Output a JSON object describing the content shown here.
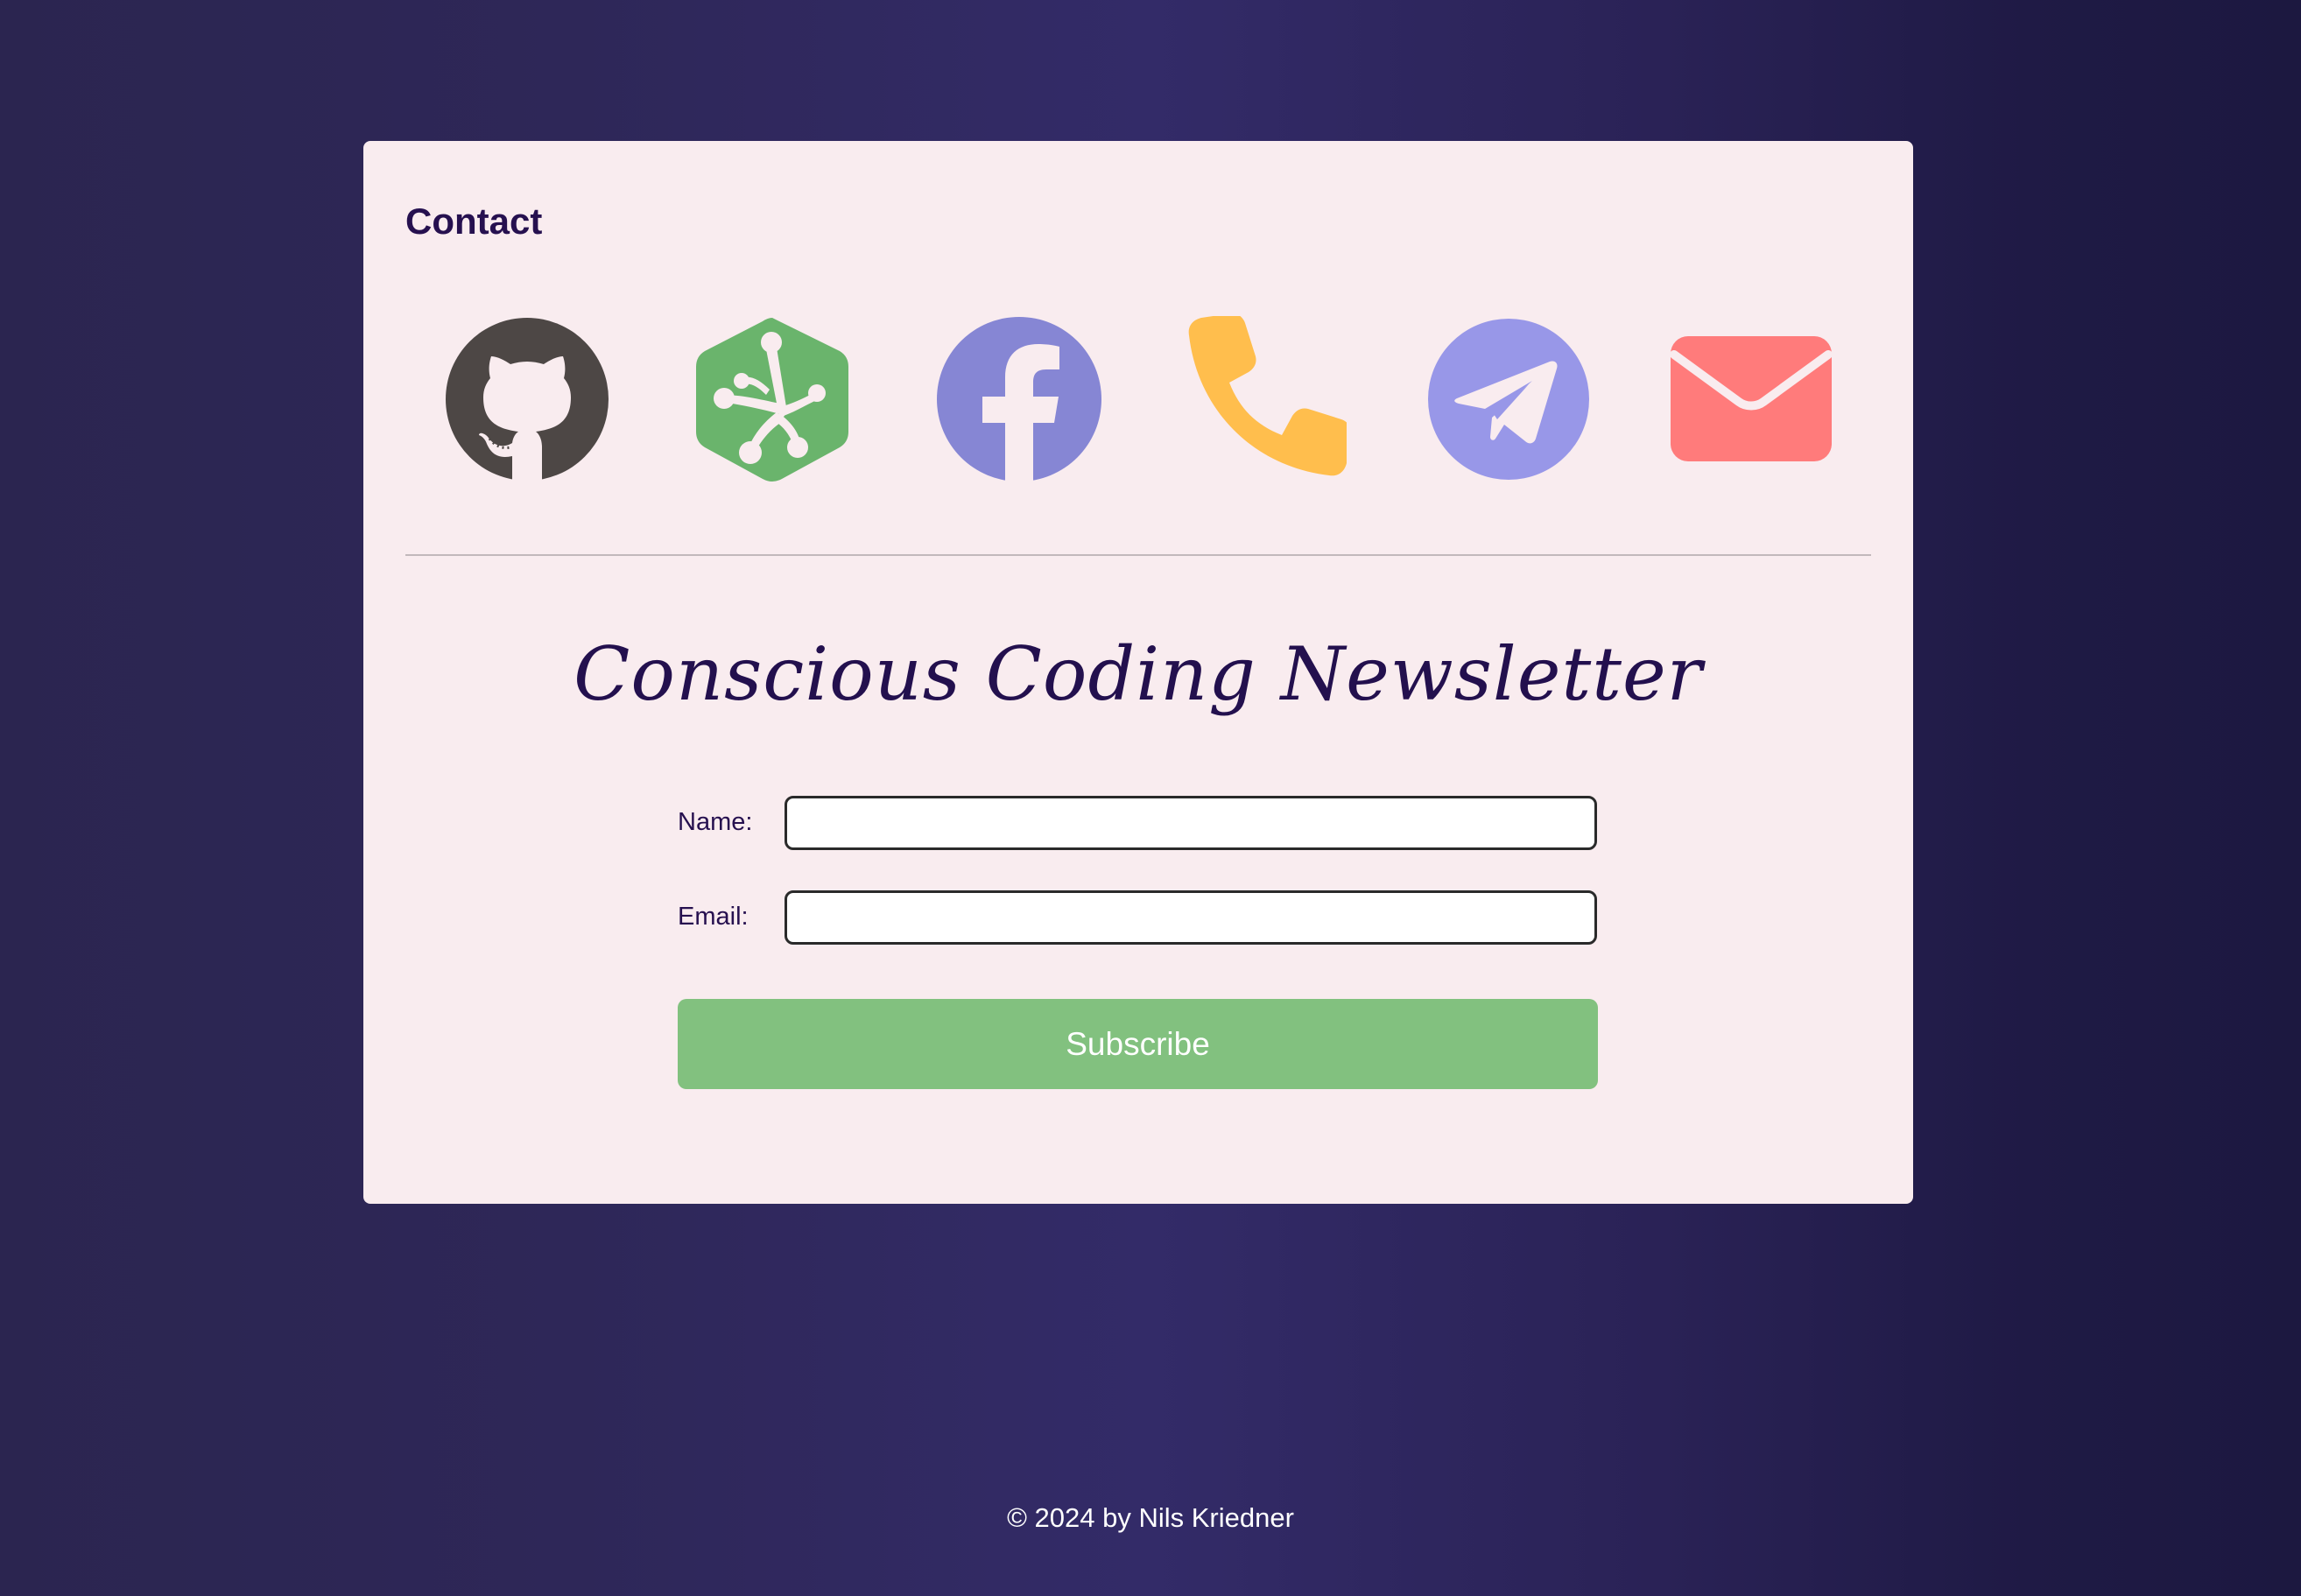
{
  "contact": {
    "title": "Contact",
    "icons": [
      {
        "name": "github-icon",
        "color": "#4d4745"
      },
      {
        "name": "treehouse-icon",
        "color": "#6ab46c"
      },
      {
        "name": "facebook-icon",
        "color": "#8686d4"
      },
      {
        "name": "phone-icon",
        "color": "#ffbe4d"
      },
      {
        "name": "telegram-icon",
        "color": "#9897e8"
      },
      {
        "name": "email-icon",
        "color": "#ff7b7b"
      }
    ]
  },
  "newsletter": {
    "title": "Conscious Coding Newsletter",
    "name_label": "Name:",
    "name_value": "",
    "email_label": "Email:",
    "email_value": "",
    "subscribe_label": "Subscribe"
  },
  "footer": {
    "text": "© 2024 by Nils Kriedner"
  },
  "colors": {
    "card_background": "#f9ecef",
    "heading": "#26104f",
    "button": "#82c17f",
    "page_background": "#2e2758"
  }
}
